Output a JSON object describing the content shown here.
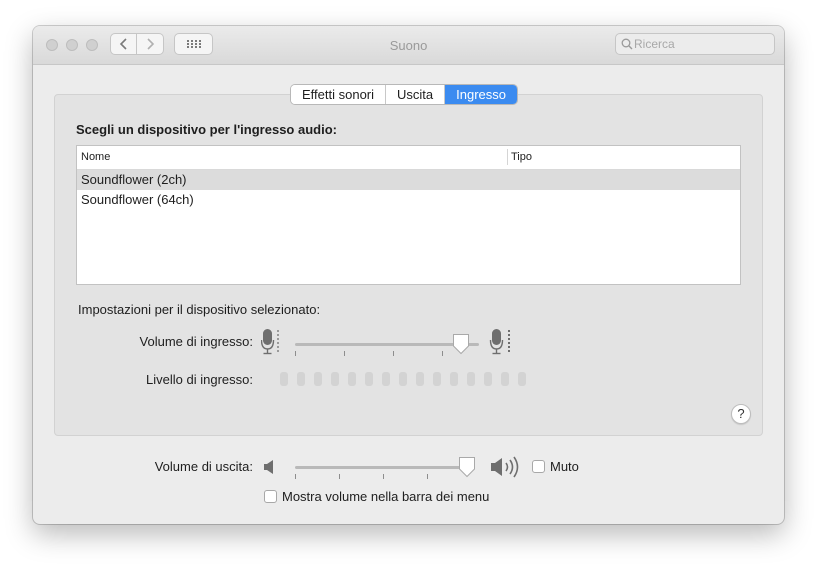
{
  "window": {
    "title": "Suono"
  },
  "toolbar": {
    "search_placeholder": "Ricerca"
  },
  "tabs": [
    {
      "label": "Effetti sonori",
      "active": false
    },
    {
      "label": "Uscita",
      "active": false
    },
    {
      "label": "Ingresso",
      "active": true
    }
  ],
  "input": {
    "choose_label": "Scegli un dispositivo per l'ingresso audio:",
    "columns": [
      "Nome",
      "Tipo"
    ],
    "devices": [
      {
        "name": "Soundflower (2ch)",
        "type": "",
        "selected": true
      },
      {
        "name": "Soundflower (64ch)",
        "type": "",
        "selected": false
      }
    ],
    "settings_label": "Impostazioni per il dispositivo selezionato:",
    "volume_label": "Volume di ingresso:",
    "volume_value": 0.9,
    "level_label": "Livello di ingresso:",
    "level_segments_lit": 0
  },
  "output": {
    "volume_label": "Volume di uscita:",
    "volume_value": 0.98,
    "mute_label": "Muto",
    "mute_checked": false,
    "show_in_menu_label": "Mostra volume nella barra dei menu",
    "show_in_menu_checked": false
  },
  "help": {
    "label": "?"
  },
  "colors": {
    "accent": "#3b8bf0",
    "window_bg": "#ececec",
    "panel_bg": "#e3e3e3"
  }
}
